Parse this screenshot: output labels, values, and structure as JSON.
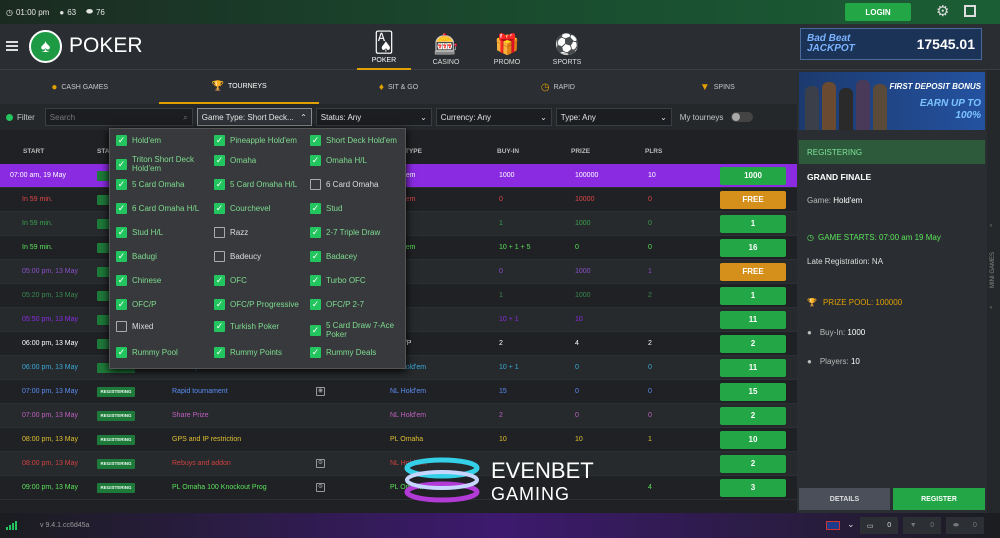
{
  "topbar": {
    "time": "01:00 pm",
    "users": "63",
    "tables": "76",
    "login": "LOGIN"
  },
  "header": {
    "brand": "POKER",
    "nav": [
      {
        "label": "POKER",
        "icon": "🂡"
      },
      {
        "label": "CASINO",
        "icon": "🎰"
      },
      {
        "label": "PROMO",
        "icon": "🎁"
      },
      {
        "label": "SPORTS",
        "icon": "⚽"
      }
    ]
  },
  "jackpot": {
    "label1": "Bad Beat",
    "label2": "JACKPOT",
    "value": "17545.01"
  },
  "tabs": [
    {
      "label": "CASH GAMES",
      "icon": "●"
    },
    {
      "label": "TOURNEYS",
      "icon": "🏆"
    },
    {
      "label": "SIT & GO",
      "icon": "♦"
    },
    {
      "label": "RAPID",
      "icon": "◷"
    },
    {
      "label": "SPINS",
      "icon": "▼"
    }
  ],
  "filters": {
    "filter_label": "Filter",
    "search_placeholder": "Search",
    "game_type": "Game Type: Short Deck...",
    "status": "Status: Any",
    "currency": "Currency: Any",
    "type": "Type: Any",
    "my_tourneys": "My tourneys"
  },
  "columns": {
    "start": "START",
    "status": "STA",
    "type": "TYPE",
    "buyin": "BUY-IN",
    "prize": "PRIZE",
    "plrs": "PLRS"
  },
  "rows": [
    {
      "start": "07:00 am, 19 May",
      "badge": "REG",
      "name": "",
      "type": "Hold'em",
      "buyin": "1000",
      "prize": "100000",
      "plrs": "10",
      "action": "1000",
      "color": "#ffffff",
      "bg": "#8a2be2",
      "btn": "#22a646"
    },
    {
      "start": "In 59 min.",
      "badge": "REG",
      "name": "",
      "type": "Hold'em",
      "buyin": "0",
      "prize": "10000",
      "plrs": "0",
      "action": "FREE",
      "color": "#e04848",
      "bg": "",
      "btn": "#d4901a"
    },
    {
      "start": "In 59 min.",
      "badge": "REG",
      "name": "",
      "type": "",
      "buyin": "1",
      "prize": "1000",
      "plrs": "0",
      "action": "1",
      "color": "#3aa04e",
      "bg": "",
      "btn": "#22a646"
    },
    {
      "start": "In 59 min.",
      "badge": "REG",
      "name": "",
      "type": "Hold'em",
      "buyin": "10 + 1 + 5",
      "prize": "0",
      "plrs": "0",
      "action": "16",
      "color": "#5be35b",
      "bg": "",
      "btn": "#22a646"
    },
    {
      "start": "05:00 pm, 13 May",
      "badge": "REG",
      "name": "",
      "type": "",
      "buyin": "0",
      "prize": "1000",
      "plrs": "1",
      "action": "FREE",
      "color": "#8a4fc8",
      "bg": "",
      "btn": "#d4901a"
    },
    {
      "start": "05:20 pm, 13 May",
      "badge": "REG",
      "name": "",
      "type": "",
      "buyin": "1",
      "prize": "1000",
      "plrs": "2",
      "action": "1",
      "color": "#3a8a4e",
      "bg": "",
      "btn": "#22a646"
    },
    {
      "start": "05:50 pm, 13 May",
      "badge": "REG",
      "name": "",
      "type": "",
      "buyin": "10 + 1",
      "prize": "10",
      "plrs": "",
      "action": "11",
      "color": "#8a2be2",
      "bg": "",
      "btn": "#22a646"
    },
    {
      "start": "06:00 pm, 13 May",
      "badge": "REG",
      "name": "",
      "type": "OFC/P",
      "buyin": "2",
      "prize": "4",
      "plrs": "2",
      "action": "2",
      "color": "#ffffff",
      "bg": "",
      "btn": "#22a646"
    },
    {
      "start": "06:00 pm, 13 May",
      "badge": "REG",
      "name": "NL entry",
      "type": "NL Hold'em",
      "buyin": "10 + 1",
      "prize": "0",
      "plrs": "0",
      "action": "11",
      "color": "#3aaad8",
      "bg": "",
      "btn": "#22a646"
    },
    {
      "start": "07:00 pm, 13 May",
      "badge": "REGISTERING",
      "name": "Rapid tournament",
      "type": "NL Hold'em",
      "buyin": "15",
      "prize": "0",
      "plrs": "0",
      "action": "15",
      "color": "#5b8ef5",
      "bg": "",
      "btn": "#22a646"
    },
    {
      "start": "07:00 pm, 13 May",
      "badge": "REGISTERING",
      "name": "Share Prize",
      "type": "NL Hold'em",
      "buyin": "2",
      "prize": "0",
      "plrs": "0",
      "action": "2",
      "color": "#c060c0",
      "bg": "",
      "btn": "#22a646"
    },
    {
      "start": "08:00 pm, 13 May",
      "badge": "REGISTERING",
      "name": "GPS and IP restriction",
      "type": "PL Omaha",
      "buyin": "10",
      "prize": "10",
      "plrs": "1",
      "action": "10",
      "color": "#e0c030",
      "bg": "",
      "btn": "#22a646"
    },
    {
      "start": "08:00 pm, 13 May",
      "badge": "REGISTERING",
      "name": "Rebuys and addon",
      "type": "NL Hold'em",
      "buyin": "",
      "prize": "",
      "plrs": "",
      "action": "2",
      "color": "#d04040",
      "bg": "",
      "btn": "#22a646"
    },
    {
      "start": "09:00 pm, 13 May",
      "badge": "REGISTERING",
      "name": "PL Omaha 100 Knockout Prog",
      "type": "PL Omaha",
      "buyin": "",
      "prize": "",
      "plrs": "4",
      "action": "3",
      "color": "#5be35b",
      "bg": "",
      "btn": "#22a646"
    }
  ],
  "dropdown": [
    {
      "label": "Hold'em",
      "on": true
    },
    {
      "label": "Pineapple Hold'em",
      "on": true
    },
    {
      "label": "Short Deck Hold'em",
      "on": true
    },
    {
      "label": "Triton Short Deck Hold'em",
      "on": true
    },
    {
      "label": "Omaha",
      "on": true
    },
    {
      "label": "Omaha H/L",
      "on": true
    },
    {
      "label": "5 Card Omaha",
      "on": true
    },
    {
      "label": "5 Card Omaha H/L",
      "on": true
    },
    {
      "label": "6 Card Omaha",
      "on": false
    },
    {
      "label": "6 Card Omaha H/L",
      "on": true
    },
    {
      "label": "Courchevel",
      "on": true
    },
    {
      "label": "Stud",
      "on": true
    },
    {
      "label": "Stud H/L",
      "on": true
    },
    {
      "label": "Razz",
      "on": false
    },
    {
      "label": "2-7 Triple Draw",
      "on": true
    },
    {
      "label": "Badugi",
      "on": true
    },
    {
      "label": "Badeucy",
      "on": false
    },
    {
      "label": "Badacey",
      "on": true
    },
    {
      "label": "Chinese",
      "on": true
    },
    {
      "label": "OFC",
      "on": true
    },
    {
      "label": "Turbo OFC",
      "on": true
    },
    {
      "label": "OFC/P",
      "on": true
    },
    {
      "label": "OFC/P Progressive",
      "on": true
    },
    {
      "label": "OFC/P 2-7",
      "on": true
    },
    {
      "label": "Mixed",
      "on": false
    },
    {
      "label": "Turkish Poker",
      "on": true
    },
    {
      "label": "5 Card Draw 7-Ace Poker",
      "on": true
    },
    {
      "label": "Rummy Pool",
      "on": true
    },
    {
      "label": "Rummy Points",
      "on": true
    },
    {
      "label": "Rummy Deals",
      "on": true
    }
  ],
  "promo": {
    "line1": "FIRST DEPOSIT BONUS",
    "line2": "EARN UP TO",
    "line3": "100%"
  },
  "details": {
    "registering": "REGISTERING",
    "title": "GRAND FINALE",
    "game_label": "Game:",
    "game": "Hold'em",
    "starts": "GAME STARTS: 07:00 am 19 May",
    "late": "Late Registration: NA",
    "prize_pool": "PRIZE POOL: 100000",
    "buyin_label": "Buy-In:",
    "buyin": "1000",
    "players_label": "Players:",
    "players": "10",
    "details_btn": "DETAILS",
    "register_btn": "REGISTER",
    "mini_games": "MINI GAMES"
  },
  "footer": {
    "version": "v 9.4.1.cc6d45a",
    "c1": "0",
    "c2": "0",
    "c3": "0"
  },
  "watermark": {
    "line1": "EVENBET",
    "line2": "GAMING"
  }
}
